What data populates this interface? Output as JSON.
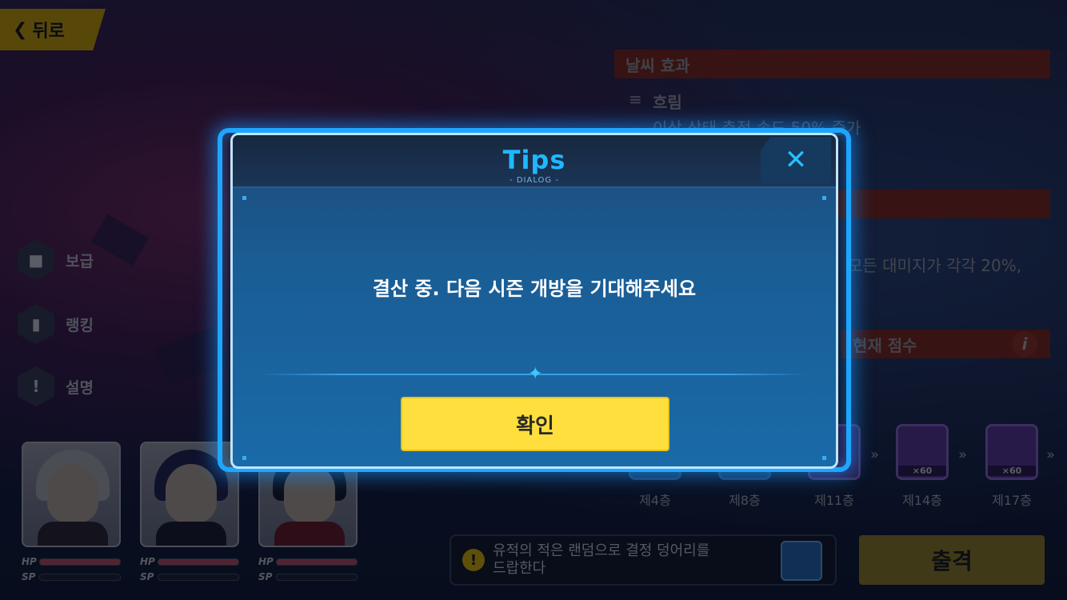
{
  "nav": {
    "back_label": "뒤로"
  },
  "left_menu": [
    {
      "label": "보급",
      "icon": "supply-icon"
    },
    {
      "label": "랭킹",
      "icon": "ranking-icon"
    },
    {
      "label": "설명",
      "icon": "info-icon"
    }
  ],
  "characters": [
    {
      "hp_label": "HP",
      "sp_label": "SP",
      "hp": 1.0,
      "sp": 0.0
    },
    {
      "hp_label": "HP",
      "sp_label": "SP",
      "hp": 1.0,
      "sp": 0.0
    },
    {
      "hp_label": "HP",
      "sp_label": "SP",
      "hp": 1.0,
      "sp": 0.0
    }
  ],
  "right_panel": {
    "weather_header": "날씨 효과",
    "weather_name": "흐림",
    "weather_desc": "이상 상태 축적 속도 50% 증가",
    "effect_desc": "모든 대미지가 각각 20%,",
    "score_header": "현재 점수",
    "floors": [
      {
        "label": "제4층",
        "qty": ""
      },
      {
        "label": "제8층",
        "qty": ""
      },
      {
        "label": "제11층",
        "qty": ""
      },
      {
        "label": "제14층",
        "qty": "×60"
      },
      {
        "label": "제17층",
        "qty": "×60"
      }
    ]
  },
  "notice": {
    "text_line1": "유적의 적은 랜덤으로 결정 덩어리를",
    "text_line2": "드랍한다"
  },
  "sortie_label": "출격",
  "dialog": {
    "title": "Tips",
    "subtitle": "- DIALOG -",
    "message": "결산 중. 다음 시즌 개방을 기대해주세요",
    "confirm_label": "확인",
    "close_symbol": "✕"
  },
  "colors": {
    "accent": "#1ea6ff",
    "confirm": "#ffdf3d",
    "title": "#1fb8ff"
  }
}
